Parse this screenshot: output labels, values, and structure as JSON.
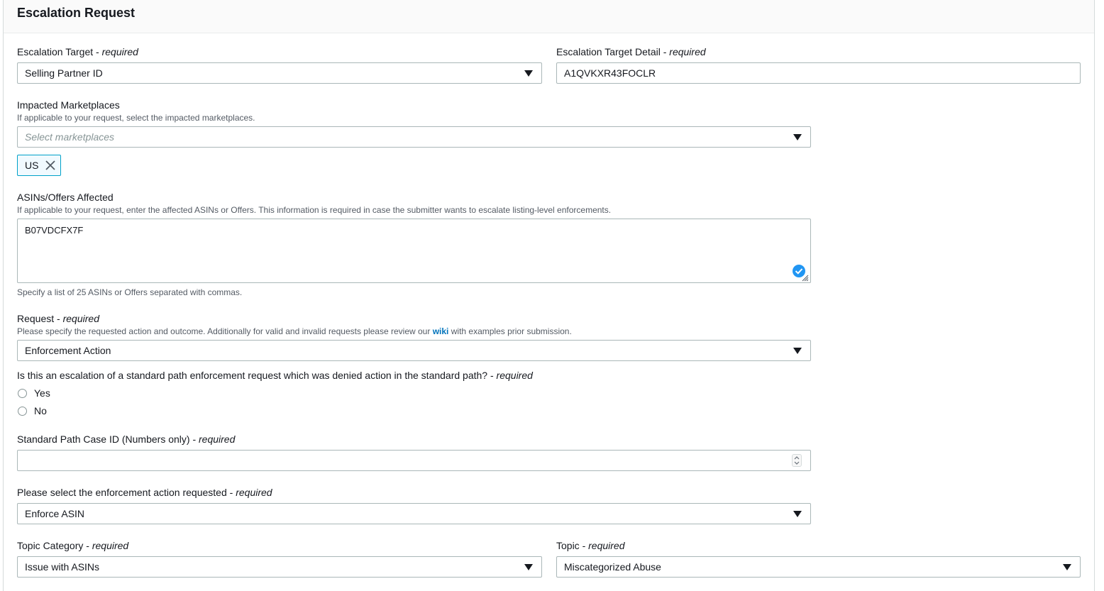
{
  "panel": {
    "title": "Escalation Request"
  },
  "required_suffix": "required",
  "escalation_target": {
    "label": "Escalation Target",
    "value": "Selling Partner ID"
  },
  "escalation_target_detail": {
    "label": "Escalation Target Detail",
    "value": "A1QVKXR43FOCLR"
  },
  "impacted_marketplaces": {
    "label": "Impacted Marketplaces",
    "description": "If applicable to your request, select the impacted marketplaces.",
    "placeholder": "Select marketplaces",
    "tokens": [
      "US"
    ]
  },
  "asins": {
    "label": "ASINs/Offers Affected",
    "description": "If applicable to your request, enter the affected ASINs or Offers. This information is required in case the submitter wants to escalate listing-level enforcements.",
    "value": "B07VDCFX7F",
    "hint": "Specify a list of 25 ASINs or Offers separated with commas."
  },
  "request": {
    "label": "Request",
    "description_before": "Please specify the requested action and outcome. Additionally for valid and invalid requests please review our",
    "link_text": "wiki",
    "description_after": "with examples prior submission.",
    "value": "Enforcement Action"
  },
  "standard_path_question": {
    "label": "Is this an escalation of a standard path enforcement request which was denied action in the standard path?",
    "options": [
      "Yes",
      "No"
    ]
  },
  "case_id": {
    "label": "Standard Path Case ID (Numbers only)",
    "value": ""
  },
  "enforcement_action": {
    "label": "Please select the enforcement action requested",
    "value": "Enforce ASIN"
  },
  "topic_category": {
    "label": "Topic Category",
    "value": "Issue with ASINs"
  },
  "topic": {
    "label": "Topic",
    "value": "Miscategorized Abuse"
  }
}
